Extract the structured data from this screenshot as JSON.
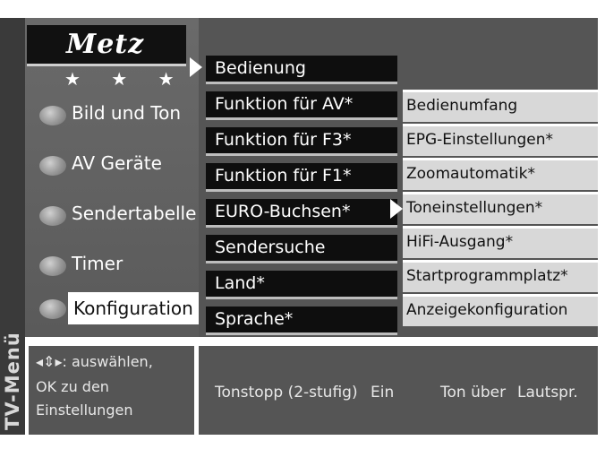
{
  "vertical_title": "TV-Menü",
  "logo": {
    "text": "Metz",
    "stars": "★ ★ ★"
  },
  "sidebar": {
    "items": [
      {
        "label": "Bild und Ton"
      },
      {
        "label": "AV Geräte"
      },
      {
        "label": "Sendertabelle"
      },
      {
        "label": "Timer"
      },
      {
        "label": "Konfiguration"
      }
    ]
  },
  "submenu": {
    "items": [
      {
        "label": "Bedienung"
      },
      {
        "label": "Funktion für AV*"
      },
      {
        "label": "Funktion für F3*"
      },
      {
        "label": "Funktion für F1*"
      },
      {
        "label": "EURO-Buchsen*"
      },
      {
        "label": "Sendersuche"
      },
      {
        "label": "Land*"
      },
      {
        "label": "Sprache*"
      }
    ]
  },
  "options": {
    "items": [
      {
        "label": "Bedienumfang"
      },
      {
        "label": "EPG-Einstellungen*"
      },
      {
        "label": "Zoomautomatik*"
      },
      {
        "label": "Toneinstellungen*"
      },
      {
        "label": "HiFi-Ausgang*"
      },
      {
        "label": "Startprogrammplatz*"
      },
      {
        "label": "Anzeigekonfiguration"
      }
    ]
  },
  "help": {
    "line1": "◂⇕▸: auswählen,",
    "line2": "OK zu den",
    "line3": "Einstellungen"
  },
  "status": {
    "setting": "Tonstopp (2-stufig)",
    "setting_value": "Ein",
    "audio_label": "Ton über",
    "audio_value": "Lautspr."
  }
}
